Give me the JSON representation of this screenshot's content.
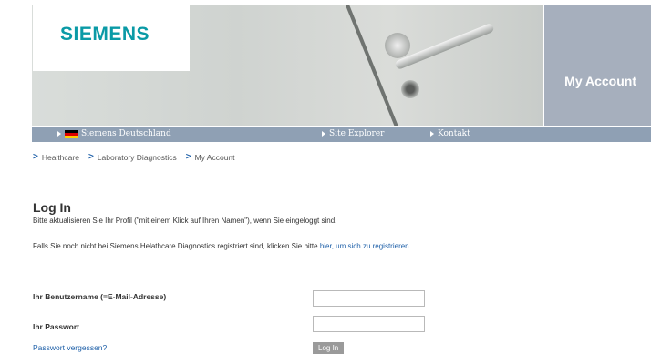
{
  "header": {
    "logo": "SIEMENS",
    "section_title": "My Account"
  },
  "nav": {
    "items": [
      {
        "label": "Siemens Deutschland",
        "icon": "german-flag-icon"
      },
      {
        "label": "Site Explorer"
      },
      {
        "label": "Kontakt"
      }
    ]
  },
  "breadcrumb": [
    "Healthcare",
    "Laboratory Diagnostics",
    "My Account"
  ],
  "login": {
    "title": "Log In",
    "info_text": "Bitte aktualisieren Sie Ihr Profil (\"mit einem Klick auf Ihren Namen\"), wenn Sie eingeloggt sind.",
    "register_text_before": "Falls Sie noch nicht bei Siemens Helathcare Diagnostics registriert sind, klicken Sie bitte ",
    "register_link": "hier, um sich zu registrieren",
    "register_text_after": ".",
    "username_label": "Ihr Benutzername (=E-Mail-Adresse)",
    "username_value": "",
    "password_label": "Ihr Passwort",
    "password_value": "",
    "forgot_link": "Passwort vergessen?",
    "submit_label": "Log In"
  },
  "colors": {
    "brand": "#0a9aa6",
    "navbar": "#8fa0b4",
    "account_panel": "#a6afbd",
    "link": "#1d5fa8"
  }
}
